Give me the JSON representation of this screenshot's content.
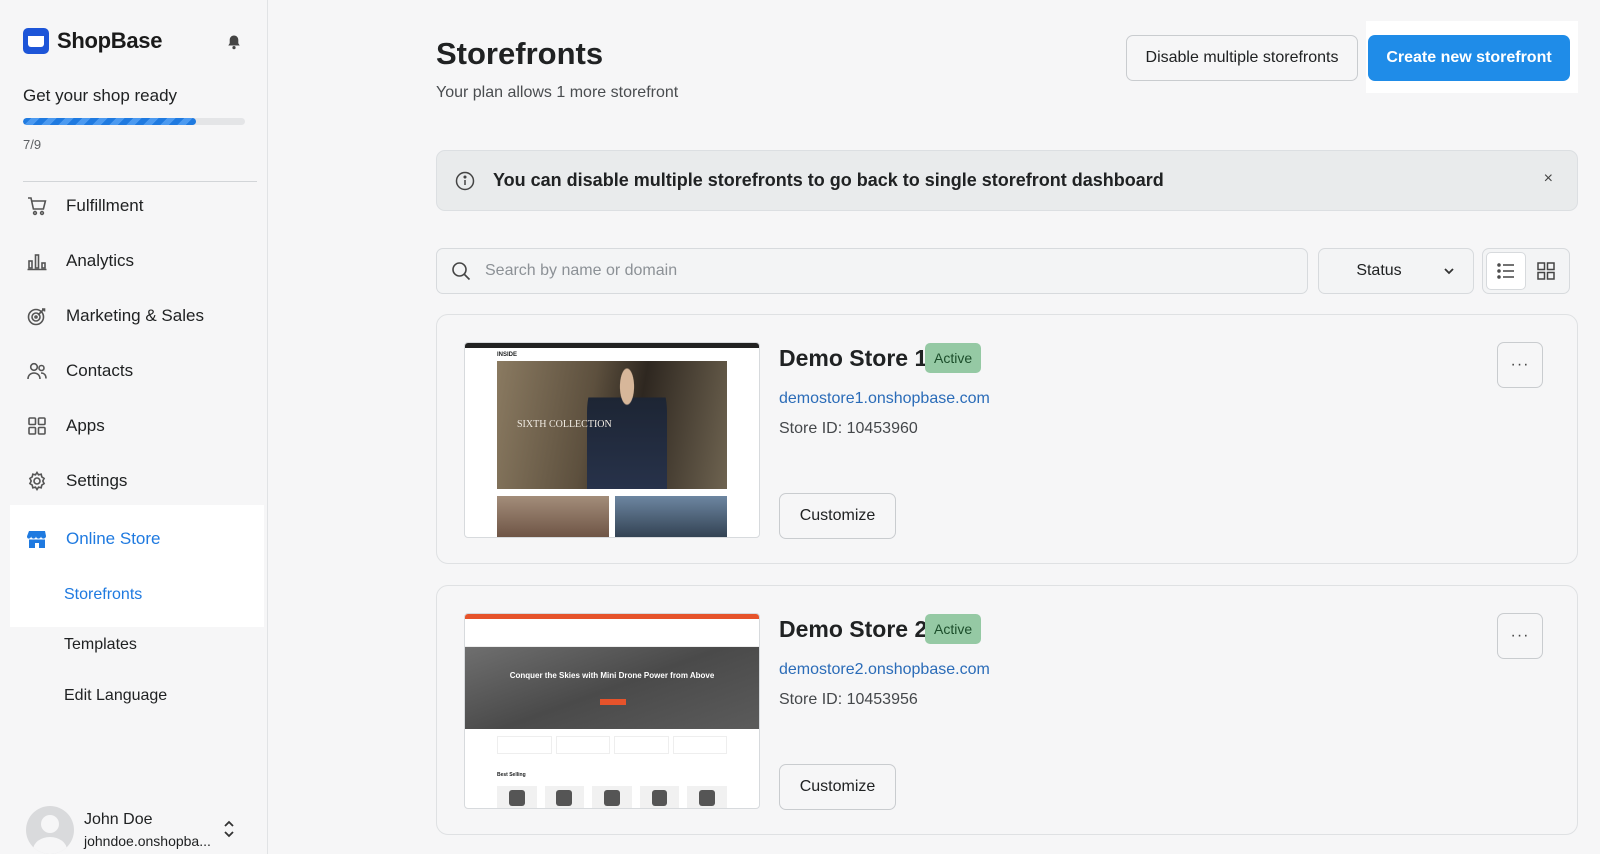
{
  "brand": {
    "name": "ShopBase"
  },
  "onboarding": {
    "title": "Get your shop ready",
    "progress_text": "7/9",
    "progress_fraction": 0.778
  },
  "sidebar": {
    "items": [
      {
        "label": "Fulfillment",
        "icon": "cart-icon"
      },
      {
        "label": "Analytics",
        "icon": "bar-chart-icon"
      },
      {
        "label": "Marketing & Sales",
        "icon": "target-icon"
      },
      {
        "label": "Contacts",
        "icon": "people-icon"
      },
      {
        "label": "Apps",
        "icon": "apps-grid-icon"
      },
      {
        "label": "Settings",
        "icon": "gear-icon"
      },
      {
        "label": "Online Store",
        "icon": "store-icon",
        "active": true
      }
    ],
    "sub_items": [
      {
        "label": "Storefronts",
        "active": true
      },
      {
        "label": "Templates"
      },
      {
        "label": "Edit Language"
      }
    ]
  },
  "user": {
    "name": "John Doe",
    "domain": "johndoe.onshopba..."
  },
  "page": {
    "title": "Storefronts",
    "subtitle": "Your plan allows 1 more storefront",
    "disable_button": "Disable multiple storefronts",
    "create_button": "Create new storefront"
  },
  "banner": {
    "text": "You can disable multiple storefronts to go back to single storefront dashboard",
    "close": "×"
  },
  "filters": {
    "search_placeholder": "Search by name or domain",
    "status_label": "Status"
  },
  "colors": {
    "accent": "#1f8ce8",
    "link": "#2b6cb8",
    "active_badge": "#95c9a4"
  },
  "stores": [
    {
      "name": "Demo Store 1",
      "status": "Active",
      "domain": "demostore1.onshopbase.com",
      "store_id": "Store ID: 10453960",
      "customize": "Customize",
      "more": "···",
      "thumb_nav": "INSIDE",
      "thumb_headline": "SIXTH COLLECTION"
    },
    {
      "name": "Demo Store 2",
      "status": "Active",
      "domain": "demostore2.onshopbase.com",
      "store_id": "Store ID: 10453956",
      "customize": "Customize",
      "more": "···",
      "thumb_headline": "Conquer the Skies with Mini Drone Power from Above",
      "thumb_section": "Best Selling"
    }
  ]
}
